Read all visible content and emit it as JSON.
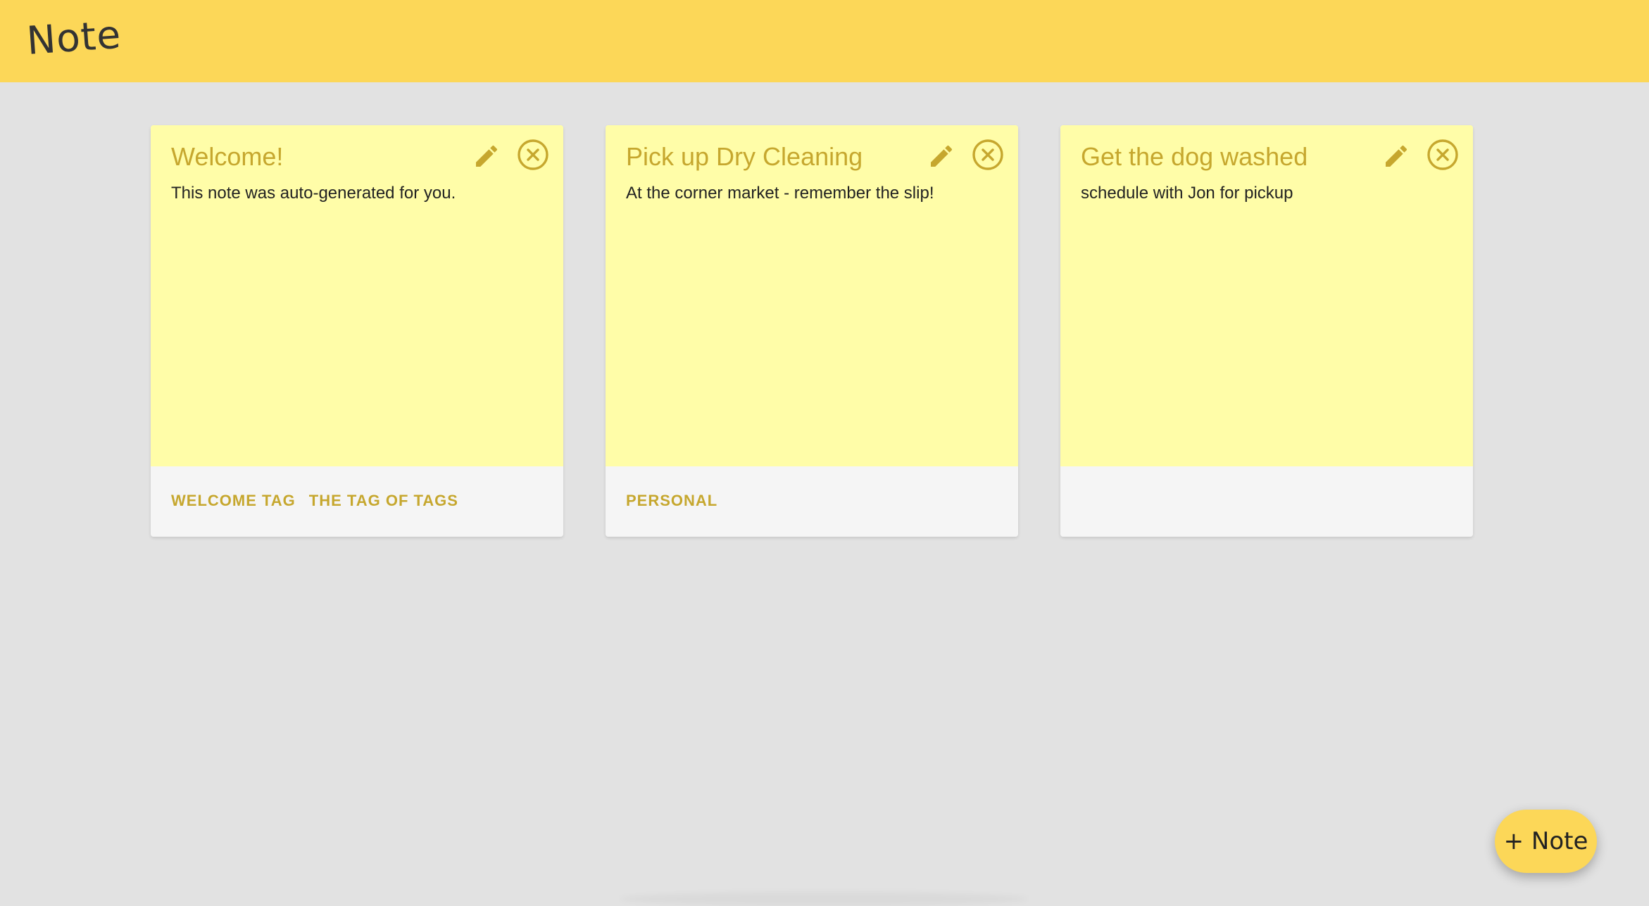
{
  "app": {
    "title": "Note"
  },
  "colors": {
    "app_bar": "#fcd758",
    "note_body": "#fffda8",
    "note_footer": "#f5f5f5",
    "accent": "#c6a72e",
    "background": "#e2e2e2"
  },
  "notes": [
    {
      "title": "Welcome!",
      "text": "This note was auto-generated for you.",
      "edit_icon": "pencil-icon",
      "delete_icon": "close-circle-icon",
      "tags": [
        "WELCOME TAG",
        "THE TAG OF TAGS"
      ]
    },
    {
      "title": "Pick up Dry Cleaning",
      "text": "At the corner market - remember the slip!",
      "edit_icon": "pencil-icon",
      "delete_icon": "close-circle-icon",
      "tags": [
        "PERSONAL"
      ]
    },
    {
      "title": "Get the dog washed",
      "text": "schedule with Jon for pickup",
      "edit_icon": "pencil-icon",
      "delete_icon": "close-circle-icon",
      "tags": []
    }
  ],
  "fab": {
    "label": "+ Note"
  }
}
